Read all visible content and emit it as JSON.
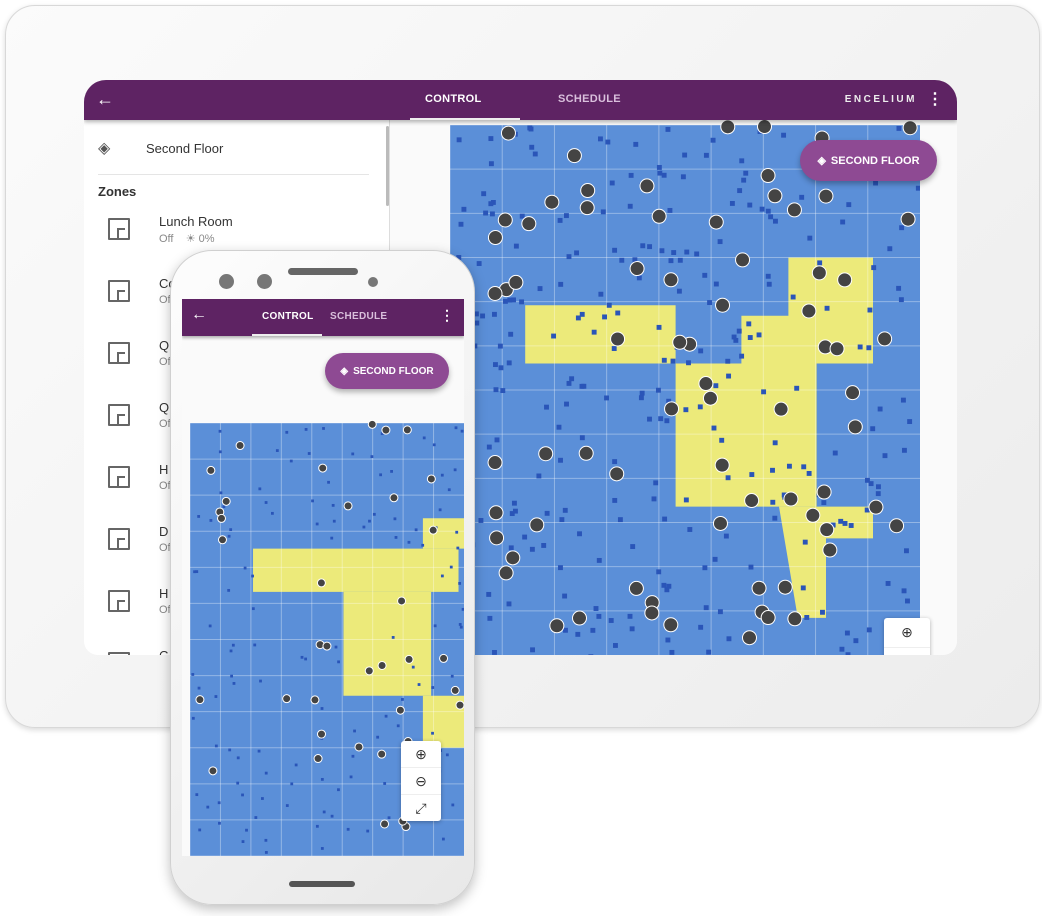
{
  "tablet": {
    "header": {
      "back_icon": "arrow-left-icon",
      "tabs": [
        {
          "label": "CONTROL",
          "active": true
        },
        {
          "label": "SCHEDULE",
          "active": false
        }
      ],
      "brand": "ENCELIUM",
      "menu_icon": "more-vert-icon"
    },
    "sidebar": {
      "floor_icon": "layers-icon",
      "floor_name": "Second Floor",
      "zones_heading": "Zones",
      "zones": [
        {
          "name": "Lunch Room",
          "state": "Off",
          "level": "☀ 0%"
        },
        {
          "name": "Co",
          "state": "Of"
        },
        {
          "name": "Q",
          "state": "Of"
        },
        {
          "name": "Q",
          "state": "Of"
        },
        {
          "name": "H",
          "state": "Of"
        },
        {
          "name": "D",
          "state": "Of"
        },
        {
          "name": "H",
          "state": "Of"
        },
        {
          "name": "C",
          "state": ""
        }
      ]
    },
    "floor_button": "SECOND FLOOR"
  },
  "phone": {
    "header": {
      "back_icon": "arrow-left-icon",
      "tabs": [
        {
          "label": "CONTROL",
          "active": true
        },
        {
          "label": "SCHEDULE",
          "active": false
        }
      ],
      "menu_icon": "more-vert-icon"
    },
    "floor_button": "SECOND FLOOR",
    "zoom_controls": [
      "zoom-in-icon",
      "zoom-out-icon",
      "fullscreen-icon"
    ]
  },
  "colors": {
    "header": "#5e2363",
    "button": "#8e4a93",
    "zone_blue": "#5b8fd8",
    "zone_yellow": "#ecea7a"
  }
}
